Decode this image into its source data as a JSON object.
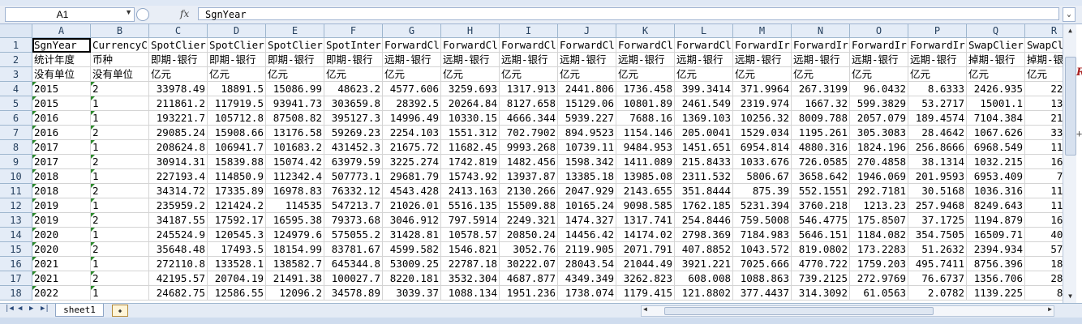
{
  "formula_bar": {
    "name_box": "A1",
    "formula": "SgnYear",
    "fx_label": "fx"
  },
  "sheet": {
    "columns": [
      "A",
      "B",
      "C",
      "D",
      "E",
      "F",
      "G",
      "H",
      "I",
      "J",
      "K",
      "L",
      "M",
      "N",
      "O",
      "P",
      "Q",
      "R"
    ],
    "row_numbers": [
      "1",
      "2",
      "3",
      "4",
      "5",
      "6",
      "7",
      "8",
      "9",
      "10",
      "11",
      "12",
      "13",
      "14",
      "15",
      "16",
      "17",
      "18"
    ],
    "rows": [
      [
        "SgnYear",
        "CurrencyC",
        "SpotClier",
        "SpotClier",
        "SpotClier",
        "SpotInter",
        "ForwardCl",
        "ForwardCl",
        "ForwardCl",
        "ForwardCl",
        "ForwardCl",
        "ForwardCl",
        "ForwardIr",
        "ForwardIr",
        "ForwardIr",
        "ForwardIr",
        "SwapClier",
        "SwapCl"
      ],
      [
        "统计年度",
        "币种",
        "即期-银行",
        "即期-银行",
        "即期-银行",
        "即期-银行",
        "远期-银行",
        "远期-银行",
        "远期-银行",
        "远期-银行",
        "远期-银行",
        "远期-银行",
        "远期-银行",
        "远期-银行",
        "远期-银行",
        "远期-银行",
        "掉期-银行",
        "掉期-银"
      ],
      [
        "没有单位",
        "没有单位",
        "亿元",
        "亿元",
        "亿元",
        "亿元",
        "亿元",
        "亿元",
        "亿元",
        "亿元",
        "亿元",
        "亿元",
        "亿元",
        "亿元",
        "亿元",
        "亿元",
        "亿元",
        "亿元"
      ],
      [
        "2015",
        "2",
        "33978.49",
        "18891.5",
        "15086.99",
        "48623.2",
        "4577.606",
        "3259.693",
        "1317.913",
        "2441.806",
        "1736.458",
        "399.3414",
        "371.9964",
        "267.3199",
        "96.0432",
        "8.6333",
        "2426.935",
        "2214."
      ],
      [
        "2015",
        "1",
        "211861.2",
        "117919.5",
        "93941.73",
        "303659.8",
        "28392.5",
        "20264.84",
        "8127.658",
        "15129.06",
        "10801.89",
        "2461.549",
        "2319.974",
        "1667.32",
        "599.3829",
        "53.2717",
        "15001.1",
        "13683"
      ],
      [
        "2016",
        "1",
        "193221.7",
        "105712.8",
        "87508.82",
        "395127.3",
        "14996.49",
        "10330.15",
        "4666.344",
        "5939.227",
        "7688.16",
        "1369.103",
        "10256.32",
        "8009.788",
        "2057.079",
        "189.4574",
        "7104.384",
        "2182."
      ],
      [
        "2016",
        "2",
        "29085.24",
        "15908.66",
        "13176.58",
        "59269.23",
        "2254.103",
        "1551.312",
        "702.7902",
        "894.9523",
        "1154.146",
        "205.0041",
        "1529.034",
        "1195.261",
        "305.3083",
        "28.4642",
        "1067.626",
        "331.1"
      ],
      [
        "2017",
        "1",
        "208624.8",
        "106941.7",
        "101683.2",
        "431452.3",
        "21675.72",
        "11682.45",
        "9993.268",
        "10739.11",
        "9484.953",
        "1451.651",
        "6954.814",
        "4880.316",
        "1824.196",
        "256.8666",
        "6968.549",
        "1111."
      ],
      [
        "2017",
        "2",
        "30914.31",
        "15839.88",
        "15074.42",
        "63979.59",
        "3225.274",
        "1742.819",
        "1482.456",
        "1598.342",
        "1411.089",
        "215.8433",
        "1033.676",
        "726.0585",
        "270.4858",
        "38.1314",
        "1032.215",
        "162.8"
      ],
      [
        "2018",
        "1",
        "227193.4",
        "114850.9",
        "112342.4",
        "507773.1",
        "29681.79",
        "15743.92",
        "13937.87",
        "13385.18",
        "13985.08",
        "2311.532",
        "5806.67",
        "3658.642",
        "1946.069",
        "201.9593",
        "6953.409",
        "772."
      ],
      [
        "2018",
        "2",
        "34314.72",
        "17335.89",
        "16978.83",
        "76332.12",
        "4543.428",
        "2413.163",
        "2130.266",
        "2047.929",
        "2143.655",
        "351.8444",
        "875.39",
        "552.1551",
        "292.7181",
        "30.5168",
        "1036.316",
        "117.0"
      ],
      [
        "2019",
        "1",
        "235959.2",
        "121424.2",
        "114535",
        "547213.7",
        "21026.01",
        "5516.135",
        "15509.88",
        "10165.24",
        "9098.585",
        "1762.185",
        "5231.394",
        "3760.218",
        "1213.23",
        "257.9468",
        "8249.643",
        "1145."
      ],
      [
        "2019",
        "2",
        "34187.55",
        "17592.17",
        "16595.38",
        "79373.68",
        "3046.912",
        "797.5914",
        "2249.321",
        "1474.327",
        "1317.741",
        "254.8446",
        "759.5008",
        "546.4775",
        "175.8507",
        "37.1725",
        "1194.879",
        "165.1"
      ],
      [
        "2020",
        "1",
        "245524.9",
        "120545.3",
        "124979.6",
        "575055.2",
        "31428.81",
        "10578.57",
        "20850.24",
        "14456.42",
        "14174.02",
        "2798.369",
        "7184.983",
        "5646.151",
        "1184.082",
        "354.7505",
        "16509.71",
        "4010."
      ],
      [
        "2020",
        "2",
        "35648.48",
        "17493.5",
        "18154.99",
        "83781.67",
        "4599.582",
        "1546.821",
        "3052.76",
        "2119.905",
        "2071.791",
        "407.8852",
        "1043.572",
        "819.0802",
        "173.2283",
        "51.2632",
        "2394.934",
        "578.9"
      ],
      [
        "2021",
        "1",
        "272110.8",
        "133528.1",
        "138582.7",
        "645344.8",
        "53009.25",
        "22787.18",
        "30222.07",
        "28043.54",
        "21044.49",
        "3921.221",
        "7025.666",
        "4770.722",
        "1759.203",
        "495.7411",
        "8756.396",
        "1834."
      ],
      [
        "2021",
        "2",
        "42195.57",
        "20704.19",
        "21491.38",
        "100027.7",
        "8220.181",
        "3532.304",
        "4687.877",
        "4349.349",
        "3262.823",
        "608.008",
        "1088.863",
        "739.2125",
        "272.9769",
        "76.6737",
        "1356.706",
        "284.2"
      ],
      [
        "2022",
        "1",
        "24682.75",
        "12586.55",
        "12096.2",
        "34578.89",
        "3039.37",
        "1088.134",
        "1951.236",
        "1738.074",
        "1179.415",
        "121.8802",
        "377.4437",
        "314.3092",
        "61.0563",
        "2.0782",
        "1139.225",
        "81.8"
      ]
    ]
  },
  "tabs": {
    "sheet_name": "sheet1",
    "nav_first": "⏮",
    "nav_prev": "◀",
    "nav_next": "▶",
    "nav_last": "⏭"
  },
  "side_fragment": {
    "glyph_r": "R"
  }
}
